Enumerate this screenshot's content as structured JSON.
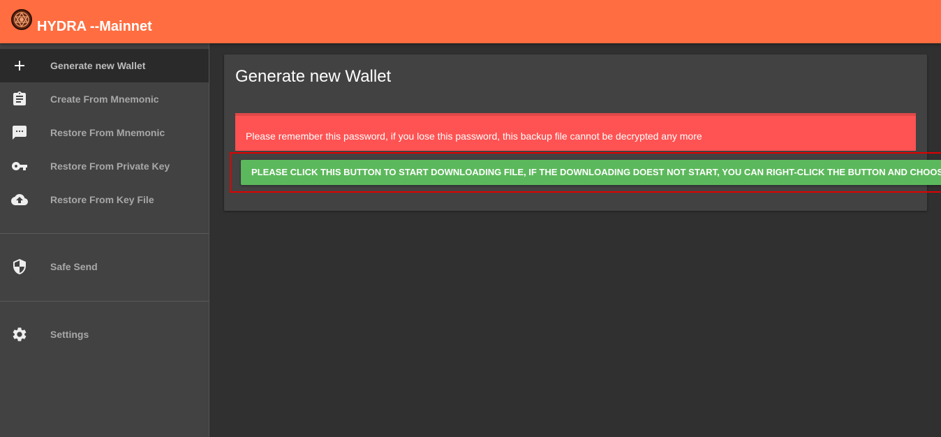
{
  "header": {
    "title": "HYDRA --Mainnet",
    "logo": "hydra-logo-icon",
    "background_color": "#ff6d40"
  },
  "sidebar": {
    "items": [
      {
        "label": "Generate new Wallet",
        "icon": "plus-icon",
        "active": true
      },
      {
        "label": "Create From Mnemonic",
        "icon": "clipboard-icon",
        "active": false
      },
      {
        "label": "Restore From Mnemonic",
        "icon": "chat-bubble-icon",
        "active": false
      },
      {
        "label": "Restore From Private Key",
        "icon": "key-icon",
        "active": false
      },
      {
        "label": "Restore From Key File",
        "icon": "cloud-upload-icon",
        "active": false
      }
    ],
    "secondary_items": [
      {
        "label": "Safe Send",
        "icon": "shield-icon"
      }
    ],
    "tertiary_items": [
      {
        "label": "Settings",
        "icon": "gear-icon"
      }
    ]
  },
  "main": {
    "title": "Generate new Wallet",
    "alert": {
      "text": "Please remember this password, if you lose this password, this backup file cannot be decrypted any more",
      "color": "#ff5252"
    },
    "download_button": {
      "label": "PLEASE CLICK THIS BUTTON TO START DOWNLOADING FILE, IF THE DOWNLOADING DOEST NOT START, YOU CAN RIGHT-CLICK THE BUTTON AND CHOOSE",
      "color": "#5cb85c"
    }
  }
}
